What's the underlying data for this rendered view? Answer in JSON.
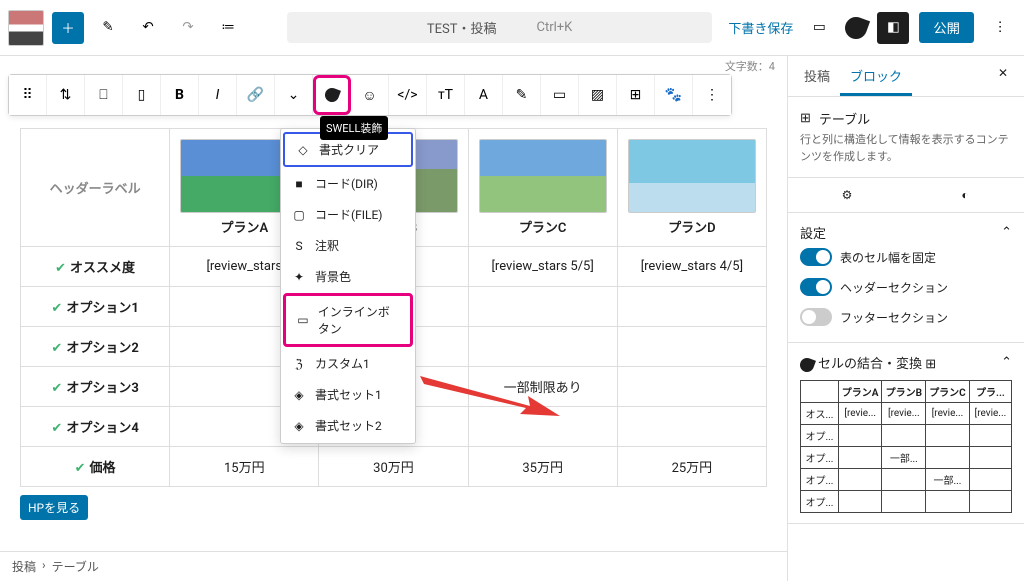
{
  "topbar": {
    "title": "TEST・投稿",
    "shortcut": "Ctrl+K",
    "save_draft": "下書き保存",
    "publish": "公開"
  },
  "editor": {
    "char_count_label": "文字数：4",
    "tooltip": "SWELL装飾",
    "toolbar_icons": [
      {
        "name": "handle-icon",
        "glyph": "⠿"
      },
      {
        "name": "drag-icon",
        "glyph": "⇅"
      },
      {
        "name": "row-icon",
        "glyph": "⎕"
      },
      {
        "name": "column-icon",
        "glyph": "▯"
      },
      {
        "name": "bold-icon",
        "glyph": "B"
      },
      {
        "name": "italic-icon",
        "glyph": "I"
      },
      {
        "name": "link-icon",
        "glyph": "🔗"
      },
      {
        "name": "chevron-down-icon",
        "glyph": "⌄"
      },
      {
        "name": "swell-icon",
        "glyph": ""
      },
      {
        "name": "emoji-icon",
        "glyph": "☺"
      },
      {
        "name": "code-icon",
        "glyph": "</>"
      },
      {
        "name": "textsize-icon",
        "glyph": "тT"
      },
      {
        "name": "fontcolor-icon",
        "glyph": "A"
      },
      {
        "name": "highlight-icon",
        "glyph": "✎"
      },
      {
        "name": "border-icon",
        "glyph": "▭"
      },
      {
        "name": "bgcolor-icon",
        "glyph": "▨"
      },
      {
        "name": "grid-icon",
        "glyph": "⊞"
      },
      {
        "name": "paw-icon",
        "glyph": "🐾"
      },
      {
        "name": "more-icon",
        "glyph": "⋮"
      }
    ],
    "dropdown": [
      {
        "icon": "◇",
        "label": "書式クリア",
        "active": true
      },
      {
        "icon": "■",
        "label": "コード(DIR)"
      },
      {
        "icon": "▢",
        "label": "コード(FILE)"
      },
      {
        "icon": "S",
        "label": "注釈"
      },
      {
        "icon": "✦",
        "label": "背景色"
      },
      {
        "icon": "▭",
        "label": "インラインボタン",
        "hlpink": true
      },
      {
        "icon": "ℨ",
        "label": "カスタム1"
      },
      {
        "icon": "◈",
        "label": "書式セット1"
      },
      {
        "icon": "◈",
        "label": "書式セット2"
      }
    ],
    "table": {
      "header_label": "ヘッダーラベル",
      "plans": [
        "プランA",
        "プランB",
        "プランC",
        "プランD"
      ],
      "rows": [
        {
          "label": "オススメ度",
          "cells": [
            "[review_stars",
            "s 3/5]",
            "[review_stars 5/5]",
            "[review_stars 4/5]"
          ]
        },
        {
          "label": "オプション1",
          "cells": [
            "",
            "",
            "",
            ""
          ]
        },
        {
          "label": "オプション2",
          "cells": [
            "",
            "り",
            "",
            ""
          ]
        },
        {
          "label": "オプション3",
          "cells": [
            "",
            "",
            "一部制限あり",
            ""
          ]
        },
        {
          "label": "オプション4",
          "cells": [
            "",
            "",
            "",
            ""
          ]
        },
        {
          "label": "価格",
          "cells": [
            "15万円",
            "30万円",
            "35万円",
            "25万円"
          ]
        }
      ],
      "chip": "HPを見る"
    },
    "crumbs": [
      "投稿",
      "›",
      "テーブル"
    ]
  },
  "sidebar": {
    "tabs": {
      "post": "投稿",
      "block": "ブロック"
    },
    "block": {
      "title": "テーブル",
      "desc": "行と列に構造化して情報を表示するコンテンツを作成します。"
    },
    "settings_title": "設定",
    "toggles": [
      {
        "label": "表のセル幅を固定",
        "on": true
      },
      {
        "label": "ヘッダーセクション",
        "on": true
      },
      {
        "label": "フッターセクション",
        "on": false
      }
    ],
    "merge_title": "セルの結合・変換",
    "minitable": {
      "headers": [
        "",
        "プランA",
        "プランB",
        "プランC",
        "プラ..."
      ],
      "rows": [
        [
          "オス...",
          "[revie...",
          "[revie...",
          "[revie...",
          "[revie..."
        ],
        [
          "オプ...",
          "",
          "",
          "",
          ""
        ],
        [
          "オプ...",
          "",
          "一部...",
          "",
          ""
        ],
        [
          "オプ...",
          "",
          "",
          "一部...",
          ""
        ],
        [
          "オプ...",
          "",
          "",
          "",
          ""
        ]
      ]
    }
  },
  "chart_data": null
}
